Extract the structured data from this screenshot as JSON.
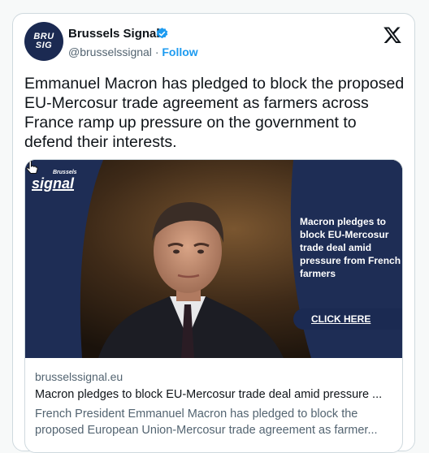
{
  "author": {
    "avatar_line1": "BRU",
    "avatar_line2": "SIG",
    "name": "Brussels Signal",
    "handle": "@brusselssignal",
    "separator": "·",
    "follow_label": "Follow"
  },
  "tweet": {
    "text": "Emmanuel Macron has pledged to block the proposed EU-Mercosur trade agreement as farmers across France ramp up pressure on the government to defend their interests."
  },
  "card": {
    "brand_small_top": "Brussels",
    "brand_small_main": "signal",
    "headline": "Macron pledges to block EU-Mercosur trade deal amid pressure from French farmers",
    "cta_label": "CLICK HERE",
    "domain": "brusselssignal.eu",
    "title": "Macron pledges to block EU-Mercosur trade deal amid pressure ...",
    "description": "French President Emmanuel Macron has pledged to block the proposed European Union-Mercosur trade agreement as farmer..."
  },
  "colors": {
    "brand_navy": "#1b2a52",
    "link_blue": "#1d9bf0",
    "verified_blue": "#1d9bf0"
  },
  "icons": {
    "verified": "verified-badge-icon",
    "platform": "x-logo-icon",
    "cursor": "hand-cursor-icon"
  }
}
